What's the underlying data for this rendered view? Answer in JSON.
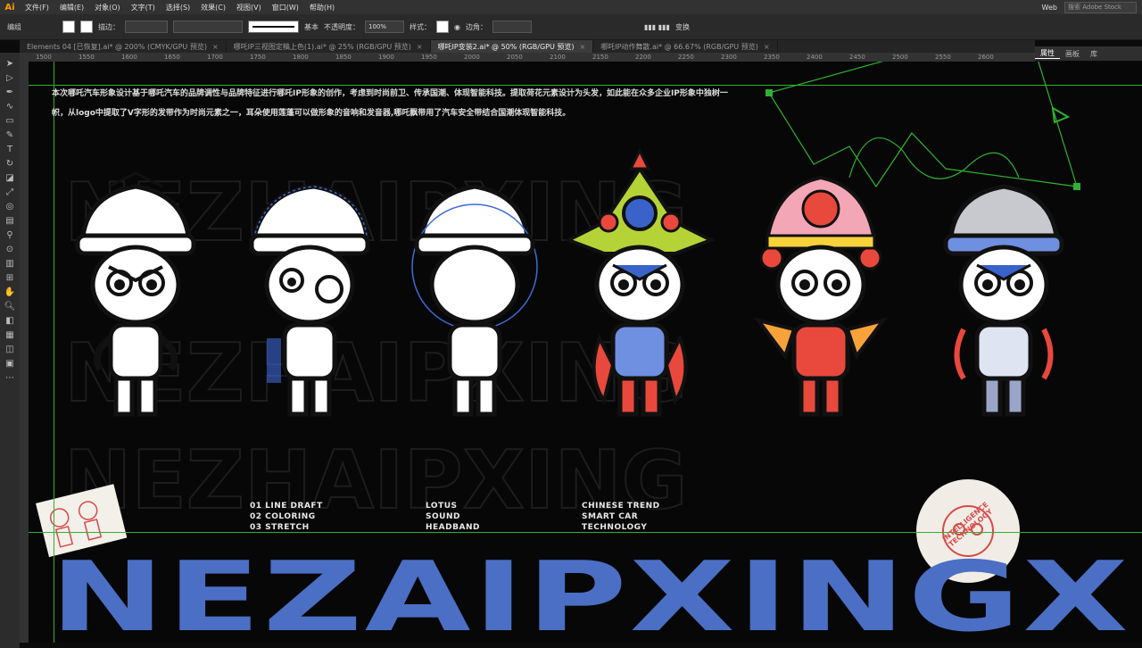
{
  "app": {
    "logo": "Ai"
  },
  "menu": [
    "文件(F)",
    "编辑(E)",
    "对象(O)",
    "文字(T)",
    "选择(S)",
    "效果(C)",
    "视图(V)",
    "窗口(W)",
    "帮助(H)"
  ],
  "menu_right": {
    "workspace": "Web",
    "search_placeholder": "搜索 Adobe Stock"
  },
  "control": {
    "label_group": "编组",
    "stroke_label": "描边：",
    "stroke_style": "基本",
    "opacity_label": "不透明度：",
    "opacity_value": "100%",
    "style_label": "样式：",
    "corner_label": "边角：",
    "transform_label": "变换"
  },
  "tabs": [
    {
      "label": "Elements 04 [已恢复].ai* @ 200% (CMYK/GPU 预览)",
      "active": false
    },
    {
      "label": "哪吒IP三视图定稿上色(1).ai* @ 25% (RGB/GPU 预览)",
      "active": false
    },
    {
      "label": "哪吒IP变装2.ai* @ 50% (RGB/GPU 预览)",
      "active": true
    },
    {
      "label": "哪吒IP动作舞散.ai* @ 66.67% (RGB/GPU 预览)",
      "active": false
    }
  ],
  "right_panel": {
    "tabs": [
      "属性",
      "画板",
      "库"
    ]
  },
  "ruler": [
    "1500",
    "1550",
    "1600",
    "1650",
    "1700",
    "1750",
    "1800",
    "1850",
    "1900",
    "1950",
    "2000",
    "2050",
    "2100",
    "2150",
    "2200",
    "2250",
    "2300",
    "2350",
    "2400",
    "2450",
    "2500",
    "2550",
    "2600"
  ],
  "artwork": {
    "description": "本次哪吒汽车形象设计基于哪吒汽车的品牌调性与品牌特征进行哪吒IP形象的创作，考虑到时尚前卫、传承国潮、体现智能科技。提取荷花元素设计为头发，如此能在众多企业IP形象中独树一帜，从logo中提取了V字形的发带作为时尚元素之一，耳朵使用莲蓬可以做形象的音响和发音器,哪吒飘带用了汽车安全带结合国潮体现智能科技。",
    "list1": [
      "01 LINE DRAFT",
      "02 COLORING",
      "03 STRETCH"
    ],
    "list2": [
      "LOTUS",
      "SOUND",
      "HEADBAND"
    ],
    "list3": [
      "CHINESE TREND",
      "SMART CAR",
      "TECHNOLOGY"
    ],
    "big_word": "NEZAIPXINGX",
    "sticker_text": "INTELLIGENCE TECHNOLOGY"
  },
  "colors": {
    "accent_blue": "#4b6fc4",
    "guide_green": "#2fb22f",
    "ai_orange": "#ff9a00"
  }
}
